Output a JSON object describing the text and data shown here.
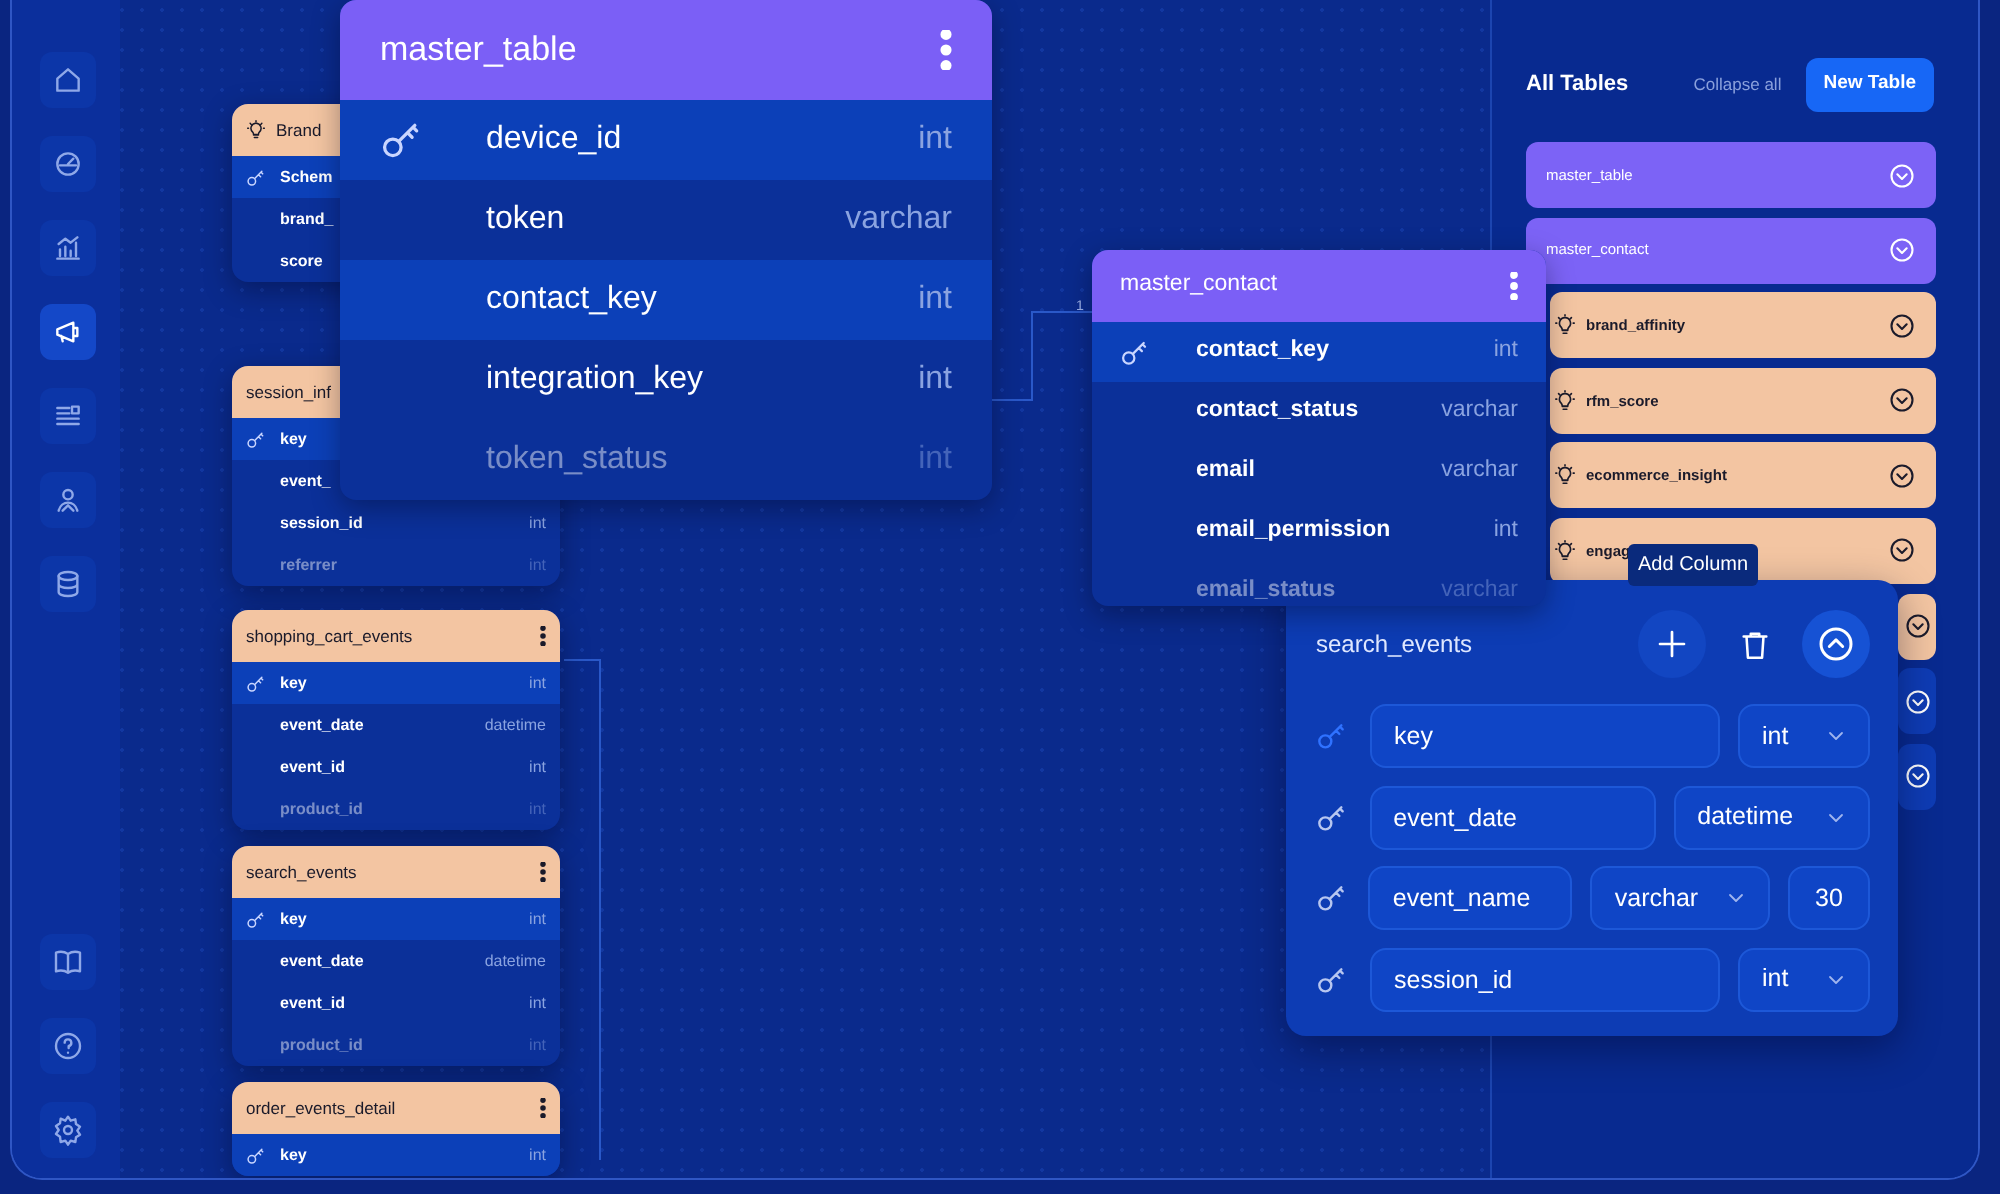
{
  "sidebar": {
    "items": [
      {
        "selected": false
      },
      {
        "selected": false
      },
      {
        "selected": false
      },
      {
        "selected": true
      },
      {
        "selected": false
      },
      {
        "selected": false
      },
      {
        "selected": false
      }
    ],
    "bottom_items": [
      {
        "selected": false
      },
      {
        "selected": false
      },
      {
        "selected": false
      }
    ]
  },
  "canvas_tables": [
    {
      "name": "Brand",
      "kind": "insight",
      "clipped": false,
      "rows": [
        {
          "name": "Schem",
          "key": true,
          "selected": true
        },
        {
          "name": "brand_",
          "key": false,
          "selected": false
        },
        {
          "name": "score",
          "key": false,
          "selected": false
        }
      ]
    },
    {
      "name": "session_inf",
      "kind": "event",
      "clipped": true,
      "rows": [
        {
          "name": "key",
          "key": true,
          "selected": true
        },
        {
          "name": "event_",
          "key": false,
          "selected": false
        },
        {
          "name": "session_id",
          "type": "int",
          "key": false,
          "selected": false
        },
        {
          "name": "referrer",
          "type": "int",
          "key": false,
          "selected": false
        }
      ]
    },
    {
      "name": "shopping_cart_events",
      "kind": "event",
      "clipped": true,
      "rows": [
        {
          "name": "key",
          "type": "int",
          "key": true,
          "selected": true
        },
        {
          "name": "event_date",
          "type": "datetime",
          "key": false,
          "selected": false
        },
        {
          "name": "event_id",
          "type": "int",
          "key": false,
          "selected": false
        },
        {
          "name": "product_id",
          "type": "int",
          "key": false,
          "selected": false
        }
      ]
    },
    {
      "name": "search_events",
      "kind": "event",
      "clipped": true,
      "rows": [
        {
          "name": "key",
          "type": "int",
          "key": true,
          "selected": true
        },
        {
          "name": "event_date",
          "type": "datetime",
          "key": false,
          "selected": false
        },
        {
          "name": "event_id",
          "type": "int",
          "key": false,
          "selected": false
        },
        {
          "name": "product_id",
          "type": "int",
          "key": false,
          "selected": false
        }
      ]
    },
    {
      "name": "order_events_detail",
      "kind": "event",
      "clipped": false,
      "rows": [
        {
          "name": "key",
          "type": "int",
          "key": true,
          "selected": true
        }
      ]
    },
    {
      "name": "master_table",
      "kind": "master",
      "clipped": true,
      "rows": [
        {
          "name": "device_id",
          "type": "int",
          "key": true,
          "selected": true
        },
        {
          "name": "token",
          "type": "varchar",
          "key": false,
          "selected": false
        },
        {
          "name": "contact_key",
          "type": "int",
          "key": false,
          "selected": true
        },
        {
          "name": "integration_key",
          "type": "int",
          "key": false,
          "selected": false
        },
        {
          "name": "token_status",
          "type": "int",
          "key": false,
          "selected": false
        }
      ]
    },
    {
      "name": "master_contact",
      "kind": "master",
      "clipped": true,
      "rows": [
        {
          "name": "contact_key",
          "type": "int",
          "key": true,
          "selected": true
        },
        {
          "name": "contact_status",
          "type": "varchar",
          "key": false,
          "selected": false
        },
        {
          "name": "email",
          "type": "varchar",
          "key": false,
          "selected": false
        },
        {
          "name": "email_permission",
          "type": "int",
          "key": false,
          "selected": false
        },
        {
          "name": "email_status",
          "type": "varchar",
          "key": false,
          "selected": false
        }
      ]
    }
  ],
  "relation_label": "1",
  "all_tables": {
    "title": "All Tables",
    "collapse_label": "Collapse all",
    "new_button": "New Table",
    "items": [
      {
        "name": "master_table",
        "kind": "master"
      },
      {
        "name": "master_contact",
        "kind": "master"
      },
      {
        "name": "brand_affinity",
        "kind": "insight"
      },
      {
        "name": "rfm_score",
        "kind": "insight"
      },
      {
        "name": "ecommerce_insight",
        "kind": "insight"
      },
      {
        "name": "engag",
        "kind": "insight"
      },
      {
        "kind": "insight"
      },
      {
        "kind": "other"
      },
      {
        "kind": "other"
      }
    ]
  },
  "editor": {
    "title": "search_events",
    "tooltip": "Add Column",
    "columns": [
      {
        "name": "key",
        "type": "int",
        "primary": true
      },
      {
        "name": "event_date",
        "type": "datetime",
        "primary": false
      },
      {
        "name": "event_name",
        "type": "varchar",
        "length": "30",
        "primary": false
      },
      {
        "name": "session_id",
        "type": "int",
        "primary": false
      }
    ]
  }
}
